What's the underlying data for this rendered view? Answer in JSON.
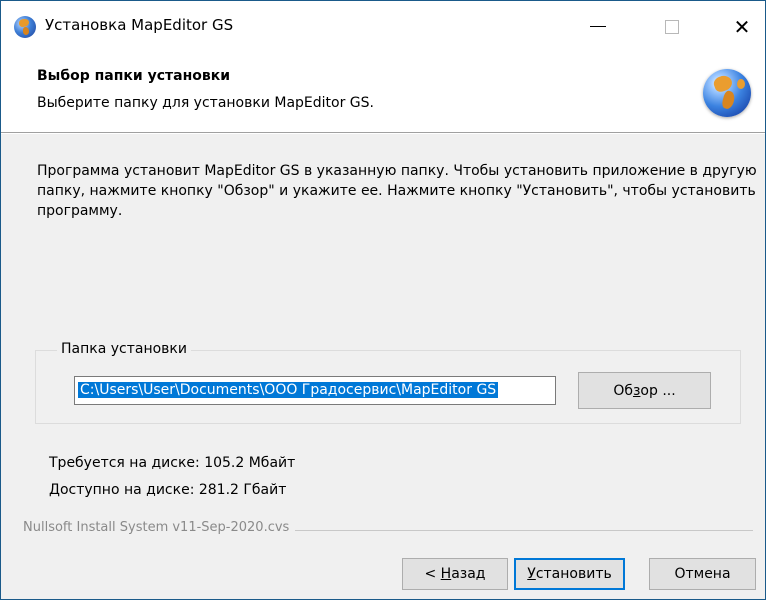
{
  "window": {
    "title": "Установка MapEditor GS",
    "controls": {
      "minimize_icon": "minimize-icon",
      "maximize_icon": "maximize-icon",
      "close_symbol": "✕"
    }
  },
  "header": {
    "title": "Выбор папки установки",
    "subtitle": "Выберите папку для установки MapEditor GS.",
    "icon": "globe-icon"
  },
  "body": {
    "description": "Программа установит MapEditor GS в указанную папку. Чтобы установить приложение в другую папку, нажмите кнопку \"Обзор\" и укажите ее. Нажмите кнопку \"Установить\", чтобы установить программу.",
    "folder_group": {
      "legend": "Папка установки",
      "path_value": "C:\\Users\\User\\Documents\\ООО Градосервис\\MapEditor GS",
      "browse_pre": "Об",
      "browse_key": "з",
      "browse_post": "ор ..."
    },
    "disk": {
      "required": "Требуется на диске: 105.2 Мбайт",
      "available": "Доступно на диске: 281.2 Гбайт"
    }
  },
  "footer": {
    "branding": "Nullsoft Install System v11-Sep-2020.cvs",
    "back_pre": "< ",
    "back_key": "Н",
    "back_post": "азад",
    "install_key": "У",
    "install_post": "становить",
    "cancel_label": "Отмена"
  },
  "colors": {
    "accent": "#0078d7",
    "title_bar": "#ffffff",
    "dialog_bg": "#f0f0f0"
  }
}
